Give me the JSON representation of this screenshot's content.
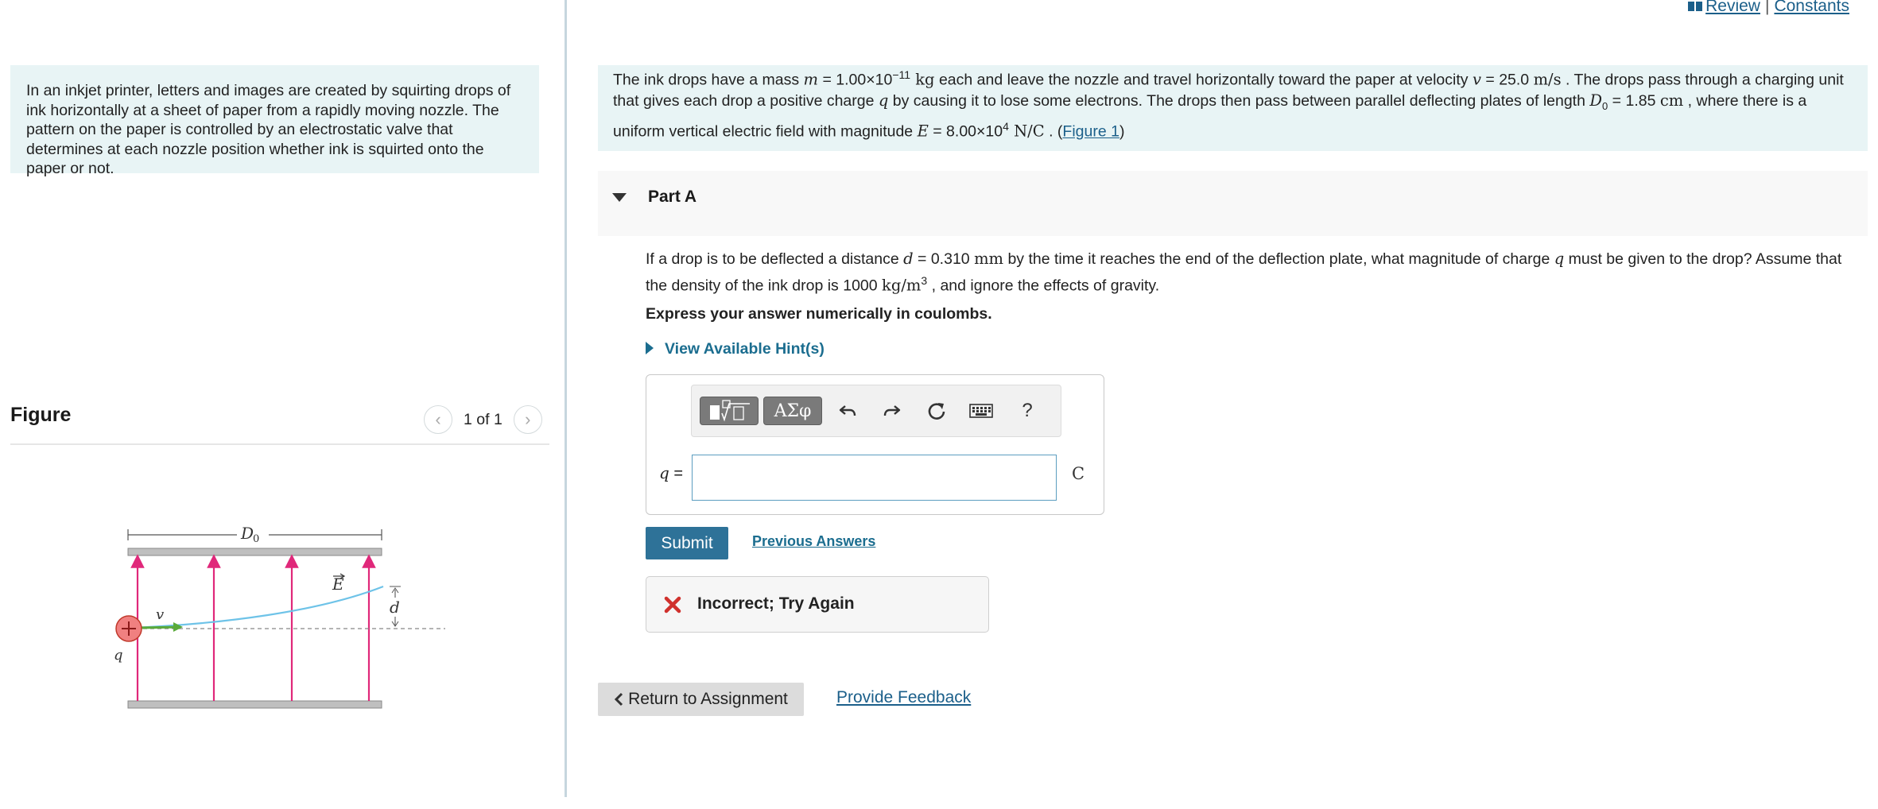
{
  "header": {
    "review_label": "Review",
    "separator": "|",
    "constants_label": "Constants"
  },
  "intro": {
    "text": "In an inkjet printer, letters and images are created by squirting drops of ink horizontally at a sheet of paper from a rapidly moving nozzle. The pattern on the paper is controlled by an electrostatic valve that determines at each nozzle position whether ink is squirted onto the paper or not."
  },
  "figure": {
    "title": "Figure",
    "pager_text": "1 of 1",
    "labels": {
      "D0": "D",
      "D0_sub": "0",
      "E": "E",
      "v": "v",
      "d": "d",
      "q": "q"
    },
    "colors": {
      "field_lines": "#e0287a",
      "trajectory": "#6ec3e8",
      "velocity": "#5aaa3a",
      "plates": "#bfbfbf",
      "charge": "#f08080"
    }
  },
  "problem": {
    "t1": "The ink drops have a mass ",
    "m_sym": "m",
    "m_val": " = 1.00×10",
    "m_exp": "−11",
    "m_unit": " kg",
    "t2": " each and leave the nozzle and travel horizontally toward the paper at velocity ",
    "v_sym": "v",
    "v_val": " = 25.0 ",
    "v_unit": "m/s",
    "t3": " . The drops pass through a charging unit that gives each drop a positive charge ",
    "q_sym": "q",
    "t4": " by causing it to lose some electrons. The drops then pass between parallel deflecting plates of length ",
    "D_sym": "D",
    "D_sub": "0",
    "D_val": " = 1.85 ",
    "D_unit": "cm",
    "t5": " , where there is a uniform vertical electric field with magnitude ",
    "E_sym": "E",
    "E_val": " = 8.00×10",
    "E_exp": "4",
    "E_unit": " N/C",
    "t6": " . (",
    "figure_link": "Figure 1",
    "t7": ")"
  },
  "part_a": {
    "label": "Part A",
    "q1": "If a drop is to be deflected a distance ",
    "d_sym": "d",
    "d_val": " = 0.310 ",
    "d_unit": "mm",
    "q2": " by the time it reaches the end of the deflection plate, what magnitude of charge ",
    "q_sym": "q",
    "q3": " must be given to the drop? Assume that the density of the ink drop is 1000 ",
    "rho_unit": "kg/m",
    "rho_exp": "3",
    "q4": " , and ignore the effects of gravity.",
    "express": "Express your answer numerically in coulombs.",
    "hints": "View Available Hint(s)",
    "answer_label": "q =",
    "answer_value": "",
    "unit": "C",
    "toolbar": {
      "greek": "ΑΣφ",
      "help": "?"
    }
  },
  "actions": {
    "submit": "Submit",
    "previous_answers": "Previous Answers",
    "feedback": "Incorrect; Try Again",
    "return": "Return to Assignment",
    "provide_feedback": "Provide Feedback"
  }
}
